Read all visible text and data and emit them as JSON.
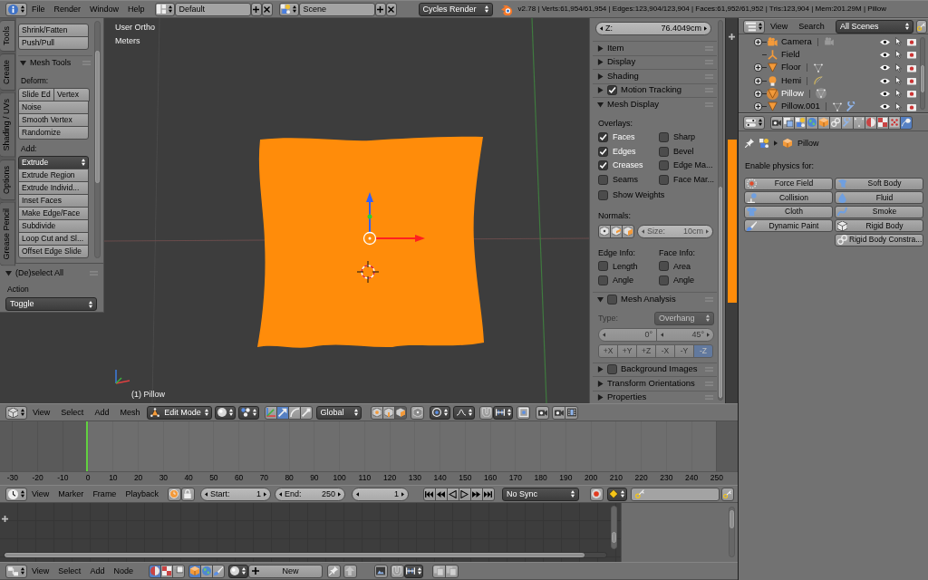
{
  "info_header": {
    "menus": [
      "File",
      "Render",
      "Window",
      "Help"
    ],
    "screen_layout": "Default",
    "scene": "Scene",
    "render_engine": "Cycles Render",
    "stats": "v2.78 | Verts:61,954/61,954 | Edges:123,904/123,904 | Faces:61,952/61,952 | Tris:123,904 | Mem:201.29M | Pillow"
  },
  "tool_shelf": {
    "tabs": [
      {
        "label": "Tools",
        "selected": true
      },
      {
        "label": "Create",
        "selected": false
      },
      {
        "label": "Shading / UVs",
        "selected": false
      },
      {
        "label": "Options",
        "selected": false
      },
      {
        "label": "Grease Pencil",
        "selected": false
      }
    ],
    "transform_buttons": [
      "Shrink/Fatten",
      "Push/Pull"
    ],
    "mesh_tools": {
      "title": "Mesh Tools",
      "expanded": true,
      "deform_label": "Deform:",
      "deform_pair": [
        "Slide Ed",
        "Vertex"
      ],
      "deform_buttons": [
        "Noise",
        "Smooth Vertex",
        "Randomize"
      ],
      "add_label": "Add:",
      "add_menu": "Extrude",
      "add_buttons": [
        "Extrude Region",
        "Extrude Individ...",
        "Inset Faces",
        "Make Edge/Face",
        "Subdivide",
        "Loop Cut and Sl...",
        "Offset Edge Slide"
      ]
    },
    "operator_panel": {
      "title": "(De)select All",
      "expanded": true,
      "action_label": "Action",
      "action_value": "Toggle"
    }
  },
  "viewport": {
    "view_name": "User Ortho",
    "units": "Meters",
    "active_object": "(1) Pillow"
  },
  "n_panel": {
    "z_field": {
      "label": "Z:",
      "value": "76.4049cm"
    },
    "panels_top": [
      {
        "title": "Item",
        "kind": "plain",
        "expanded": false
      },
      {
        "title": "Display",
        "kind": "plain",
        "expanded": false
      },
      {
        "title": "Shading",
        "kind": "plain",
        "expanded": false
      },
      {
        "title": "Motion Tracking",
        "kind": "toggle",
        "checked": true,
        "expanded": false
      }
    ],
    "mesh_display": {
      "title": "Mesh Display",
      "expanded": true,
      "overlays_label": "Overlays:",
      "overlays": [
        {
          "label": "Faces",
          "checked": true
        },
        {
          "label": "Sharp",
          "checked": false
        },
        {
          "label": "Edges",
          "checked": true
        },
        {
          "label": "Bevel",
          "checked": false
        },
        {
          "label": "Creases",
          "checked": true
        },
        {
          "label": "Edge Ma...",
          "checked": false
        },
        {
          "label": "Seams",
          "checked": false
        },
        {
          "label": "Face Mar...",
          "checked": false
        }
      ],
      "show_weights": {
        "label": "Show Weights",
        "checked": false
      },
      "normals_label": "Normals:",
      "normal_toggles": [
        {
          "kind": "vertex",
          "selected": false
        },
        {
          "kind": "loop",
          "selected": false
        },
        {
          "kind": "face",
          "selected": false
        }
      ],
      "size_field": {
        "label": "Size:",
        "value": "10cm",
        "disabled": true
      },
      "edge_info_label": "Edge Info:",
      "face_info_label": "Face Info:",
      "edge_info": [
        {
          "label": "Length",
          "checked": false
        },
        {
          "label": "Angle",
          "checked": false
        }
      ],
      "face_info": [
        {
          "label": "Area",
          "checked": false
        },
        {
          "label": "Angle",
          "checked": false
        }
      ]
    },
    "mesh_analysis": {
      "title": "Mesh Analysis",
      "kind": "toggle",
      "checked": false,
      "expanded": true,
      "type_label": "Type:",
      "type_value": "Overhang",
      "range": [
        "0°",
        "45°"
      ],
      "axes": [
        {
          "label": "+X",
          "selected": false
        },
        {
          "label": "+Y",
          "selected": false
        },
        {
          "label": "+Z",
          "selected": false
        },
        {
          "label": "-X",
          "selected": false
        },
        {
          "label": "-Y",
          "selected": false
        },
        {
          "label": "-Z",
          "selected": true
        }
      ]
    },
    "panels_bottom": [
      {
        "title": "Background Images",
        "kind": "toggle",
        "checked": false,
        "expanded": false
      },
      {
        "title": "Transform Orientations",
        "kind": "plain",
        "expanded": false
      },
      {
        "title": "Properties",
        "kind": "plain",
        "expanded": false
      }
    ]
  },
  "viewport_header": {
    "menus": [
      "View",
      "Select",
      "Add",
      "Mesh"
    ],
    "mode": "Edit Mode",
    "manipulators": [
      {
        "kind": "axes",
        "selected": false
      },
      {
        "kind": "translate",
        "selected": true
      },
      {
        "kind": "rotate",
        "selected": false
      },
      {
        "kind": "scale",
        "selected": false
      }
    ],
    "orientation": "Global",
    "select_modes": [
      {
        "kind": "vertex",
        "selected": false
      },
      {
        "kind": "edge",
        "selected": false
      },
      {
        "kind": "face",
        "selected": true
      }
    ]
  },
  "timeline": {
    "ruler": [
      "-30",
      "-20",
      "-10",
      "0",
      "10",
      "20",
      "30",
      "40",
      "50",
      "60",
      "70",
      "80",
      "90",
      "100",
      "110",
      "120",
      "130",
      "140",
      "150",
      "160",
      "170",
      "180",
      "190",
      "200",
      "210",
      "220",
      "230",
      "240",
      "250"
    ]
  },
  "timeline_header": {
    "menus": [
      "View",
      "Marker",
      "Frame",
      "Playback"
    ],
    "start": {
      "label": "Start:",
      "value": "1"
    },
    "end": {
      "label": "End:",
      "value": "250"
    },
    "current_frame": "1",
    "sync": "No Sync"
  },
  "node_header": {
    "menus": [
      "View",
      "Select",
      "Add",
      "Node"
    ],
    "shader_types": [
      {
        "kind": "shader",
        "selected": true
      },
      {
        "kind": "texture",
        "selected": false
      },
      {
        "kind": "compositing",
        "selected": false
      }
    ],
    "shader_sources": [
      {
        "kind": "object",
        "selected": true
      },
      {
        "kind": "world",
        "selected": false
      },
      {
        "kind": "line_style",
        "selected": false
      }
    ],
    "new_button": "New"
  },
  "outliner": {
    "menus": [
      "View",
      "Search"
    ],
    "display_mode": "All Scenes",
    "items": [
      {
        "name": "Camera",
        "kind": "camera",
        "selected": false,
        "modifier": false
      },
      {
        "name": "Field",
        "kind": "field",
        "selected": false,
        "modifier": false
      },
      {
        "name": "Floor",
        "kind": "mesh",
        "selected": false,
        "modifier": false
      },
      {
        "name": "Hemi",
        "kind": "lamp",
        "selected": false,
        "modifier": false
      },
      {
        "name": "Pillow",
        "kind": "mesh",
        "selected": true,
        "modifier": false
      },
      {
        "name": "Pillow.001",
        "kind": "mesh",
        "selected": false,
        "modifier": true
      }
    ]
  },
  "properties": {
    "tabs": [
      {
        "kind": "render",
        "selected": false
      },
      {
        "kind": "render_layers",
        "selected": false
      },
      {
        "kind": "scene",
        "selected": false
      },
      {
        "kind": "world",
        "selected": false
      },
      {
        "kind": "object",
        "selected": false
      },
      {
        "kind": "constraints",
        "selected": false
      },
      {
        "kind": "modifiers",
        "selected": false
      },
      {
        "kind": "data",
        "selected": false
      },
      {
        "kind": "material",
        "selected": false
      },
      {
        "kind": "texture",
        "selected": false
      },
      {
        "kind": "particles",
        "selected": false
      },
      {
        "kind": "physics",
        "selected": true
      }
    ],
    "context": "Pillow",
    "enable_label": "Enable physics for:",
    "physics_buttons": [
      {
        "label": "Force Field",
        "kind": "force_field"
      },
      {
        "label": "Soft Body",
        "kind": "soft_body"
      },
      {
        "label": "Collision",
        "kind": "collision"
      },
      {
        "label": "Fluid",
        "kind": "fluid"
      },
      {
        "label": "Cloth",
        "kind": "cloth"
      },
      {
        "label": "Smoke",
        "kind": "smoke"
      },
      {
        "label": "Dynamic Paint",
        "kind": "dynamic_paint"
      },
      {
        "label": "Rigid Body",
        "kind": "rigid_body"
      },
      {
        "label": "Rigid Body Constra...",
        "kind": "rigid_body_constraint"
      }
    ]
  }
}
